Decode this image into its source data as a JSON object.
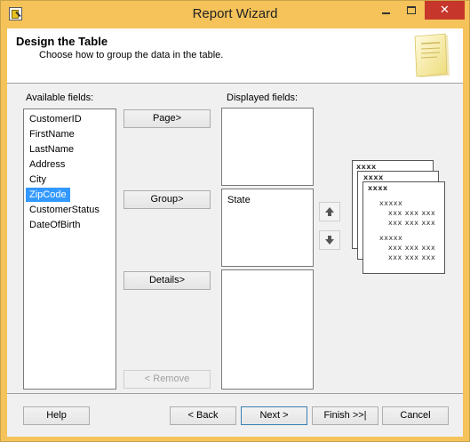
{
  "window": {
    "title": "Report Wizard",
    "close_glyph": "✕"
  },
  "header": {
    "title": "Design the Table",
    "subtitle": "Choose how to group the data in the table."
  },
  "available": {
    "label": "Available fields:",
    "items": [
      "CustomerID",
      "FirstName",
      "LastName",
      "Address",
      "City",
      "ZipCode",
      "CustomerStatus",
      "DateOfBirth"
    ],
    "selected": "ZipCode"
  },
  "displayed": {
    "label": "Displayed fields:",
    "page_items": [],
    "group_items": [
      "State"
    ],
    "details_items": []
  },
  "buttons": {
    "page": "Page>",
    "group": "Group>",
    "details": "Details>",
    "remove": "< Remove",
    "help": "Help",
    "back": "< Back",
    "next": "Next >",
    "finish": "Finish >>|",
    "cancel": "Cancel"
  },
  "preview": {
    "header1": "xxxx",
    "header2": "xxxx",
    "header3": "xxxx",
    "group1": "xxxxx",
    "row1": "xxx xxx xxx",
    "row2": "xxx xxx xxx",
    "group2": "xxxxx",
    "row3": "xxx xxx xxx",
    "row4": "xxx xxx xxx"
  },
  "icons": {
    "move_up": "arrow-up-icon",
    "move_down": "arrow-down-icon",
    "wizard_art": "report-page-icon",
    "app": "report-wizard-app-icon"
  }
}
